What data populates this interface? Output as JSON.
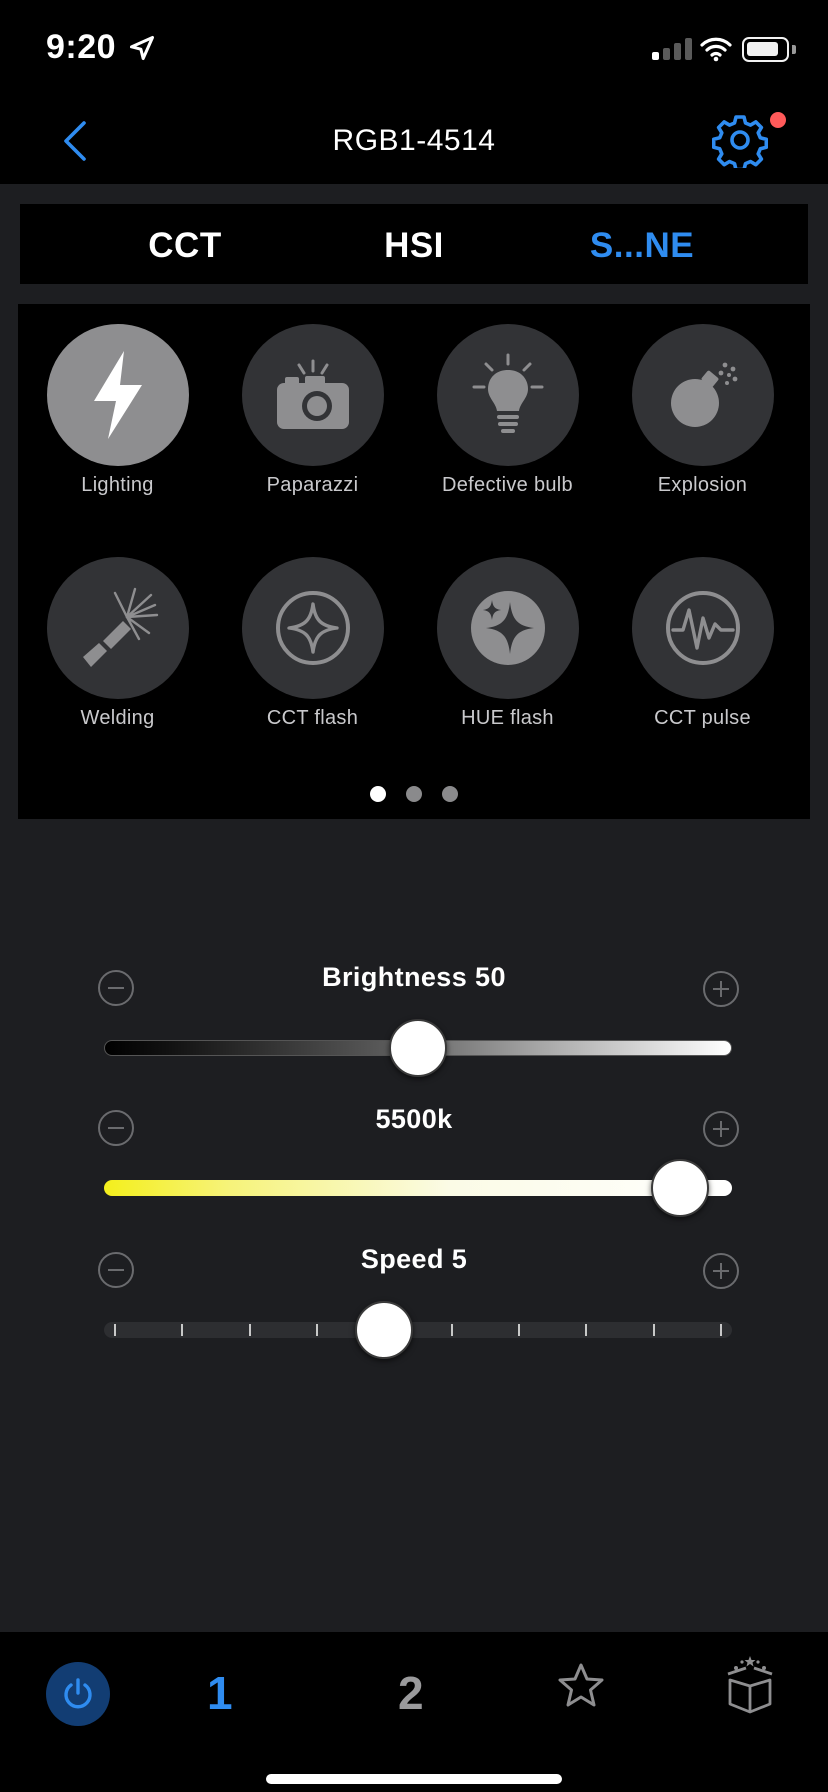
{
  "status_bar": {
    "time": "9:20"
  },
  "nav": {
    "title": "RGB1-4514"
  },
  "tabs": [
    {
      "label": "CCT",
      "active": false
    },
    {
      "label": "HSI",
      "active": false
    },
    {
      "label": "S...NE",
      "active": true
    }
  ],
  "effects": [
    {
      "label": "Lighting",
      "icon": "lightning-icon",
      "selected": true
    },
    {
      "label": "Paparazzi",
      "icon": "camera-icon",
      "selected": false
    },
    {
      "label": "Defective bulb",
      "icon": "lightbulb-icon",
      "selected": false
    },
    {
      "label": "Explosion",
      "icon": "bomb-icon",
      "selected": false
    },
    {
      "label": "Welding",
      "icon": "welding-icon",
      "selected": false
    },
    {
      "label": "CCT flash",
      "icon": "sparkle-ring-icon",
      "selected": false
    },
    {
      "label": "HUE flash",
      "icon": "sparkle-filled-icon",
      "selected": false
    },
    {
      "label": "CCT pulse",
      "icon": "pulse-icon",
      "selected": false
    }
  ],
  "pager": {
    "pages": 3,
    "current": 1
  },
  "controls": {
    "brightness": {
      "label": "Brightness 50",
      "value": 50,
      "min": 0,
      "max": 100
    },
    "cct": {
      "label": "5500k",
      "value": 5500,
      "min": 2700,
      "max": 5700
    },
    "speed": {
      "label": "Speed  5",
      "value": 5,
      "min": 1,
      "max": 10
    }
  },
  "bottom_bar": {
    "group1": "1",
    "group2": "2"
  },
  "colors": {
    "accent": "#2f8cf0",
    "background": "#1d1e21",
    "notification": "#ff5a5a"
  }
}
